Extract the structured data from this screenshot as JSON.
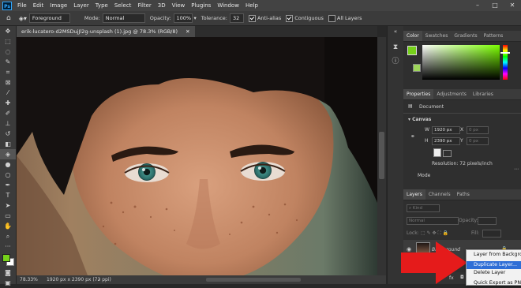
{
  "menubar": {
    "logo": "Ps",
    "items": [
      "File",
      "Edit",
      "Image",
      "Layer",
      "Type",
      "Select",
      "Filter",
      "3D",
      "View",
      "Plugins",
      "Window",
      "Help"
    ]
  },
  "options": {
    "preset": "Foreground",
    "mode_label": "Mode:",
    "mode_value": "Normal",
    "opacity_label": "Opacity:",
    "opacity_value": "100%",
    "tolerance_label": "Tolerance:",
    "tolerance_value": "32",
    "antialias_label": "Anti-alias",
    "contiguous_label": "Contiguous",
    "alllayers_label": "All Layers"
  },
  "document": {
    "tab_title": "erik-lucatero-d2MSDujJl2g-unsplash (1).jpg @ 78.3% (RGB/8)",
    "zoom": "78.33%",
    "dimensions": "1920 px x 2390 px (72 ppi)"
  },
  "color_panel": {
    "tabs": [
      "Color",
      "Swatches",
      "Gradients",
      "Patterns"
    ],
    "foreground_hex": "#76d11a",
    "background_hex": "#ffffff",
    "hue_hex": "#7bff00"
  },
  "properties_panel": {
    "tabs": [
      "Properties",
      "Adjustments",
      "Libraries"
    ],
    "doc_label": "Document",
    "section": "Canvas",
    "w_label": "W",
    "w_value": "1920 px",
    "h_label": "H",
    "h_value": "2390 px",
    "x_label": "X",
    "x_value": "0 px",
    "y_label": "Y",
    "y_value": "0 px",
    "resolution": "Resolution: 72 pixels/inch",
    "mode_label": "Mode"
  },
  "layers_panel": {
    "tabs": [
      "Layers",
      "Channels",
      "Paths"
    ],
    "filter_placeholder": "Kind",
    "blend_mode": "Normal",
    "opacity_label": "Opacity:",
    "fill_label": "Fill:",
    "lock_label": "Lock:",
    "layer_name": "Background"
  },
  "context_menu": {
    "items": [
      "Layer from Background...",
      "Duplicate Layer...",
      "Delete Layer",
      "Quick Export as PNG"
    ],
    "highlighted_index": 1
  }
}
